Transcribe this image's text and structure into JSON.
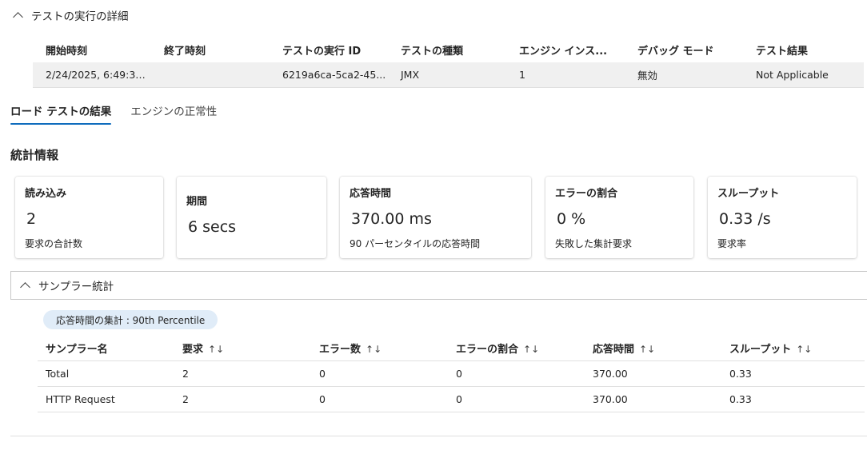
{
  "run_details": {
    "title": "テストの実行の詳細",
    "headers": [
      "開始時刻",
      "終了時刻",
      "テストの実行 ID",
      "テストの種類",
      "エンジン インス...",
      "デバッグ モード",
      "テスト結果"
    ],
    "row": [
      "2/24/2025, 6:49:35...",
      "",
      "6219a6ca-5ca2-45...",
      "JMX",
      "1",
      "無効",
      "Not Applicable"
    ]
  },
  "tabs": [
    {
      "label": "ロード テストの結果",
      "active": true
    },
    {
      "label": "エンジンの正常性",
      "active": false
    }
  ],
  "stats": {
    "title": "統計情報",
    "cards": [
      {
        "title": "読み込み",
        "value": "2",
        "sub": "要求の合計数"
      },
      {
        "title": "期間",
        "value": "6 secs",
        "sub": ""
      },
      {
        "title": "応答時間",
        "value": "370.00 ms",
        "sub": "90 パーセンタイルの応答時間"
      },
      {
        "title": "エラーの割合",
        "value": "0 %",
        "sub": "失敗した集計要求"
      },
      {
        "title": "スループット",
        "value": "0.33 /s",
        "sub": "要求率"
      }
    ]
  },
  "sampler": {
    "title": "サンプラー統計",
    "badge": "応答時間の集計 : 90th Percentile",
    "sort_glyph": "↑↓",
    "headers": [
      "サンプラー名",
      "要求",
      "エラー数",
      "エラーの割合",
      "応答時間",
      "スループット"
    ],
    "rows": [
      [
        "Total",
        "2",
        "0",
        "0",
        "370.00",
        "0.33"
      ],
      [
        "HTTP Request",
        "2",
        "0",
        "0",
        "370.00",
        "0.33"
      ]
    ]
  },
  "colors": {
    "accent": "#0f6cbd",
    "badge_bg": "#e0ecf8",
    "row_bg": "#f0f0f0"
  }
}
